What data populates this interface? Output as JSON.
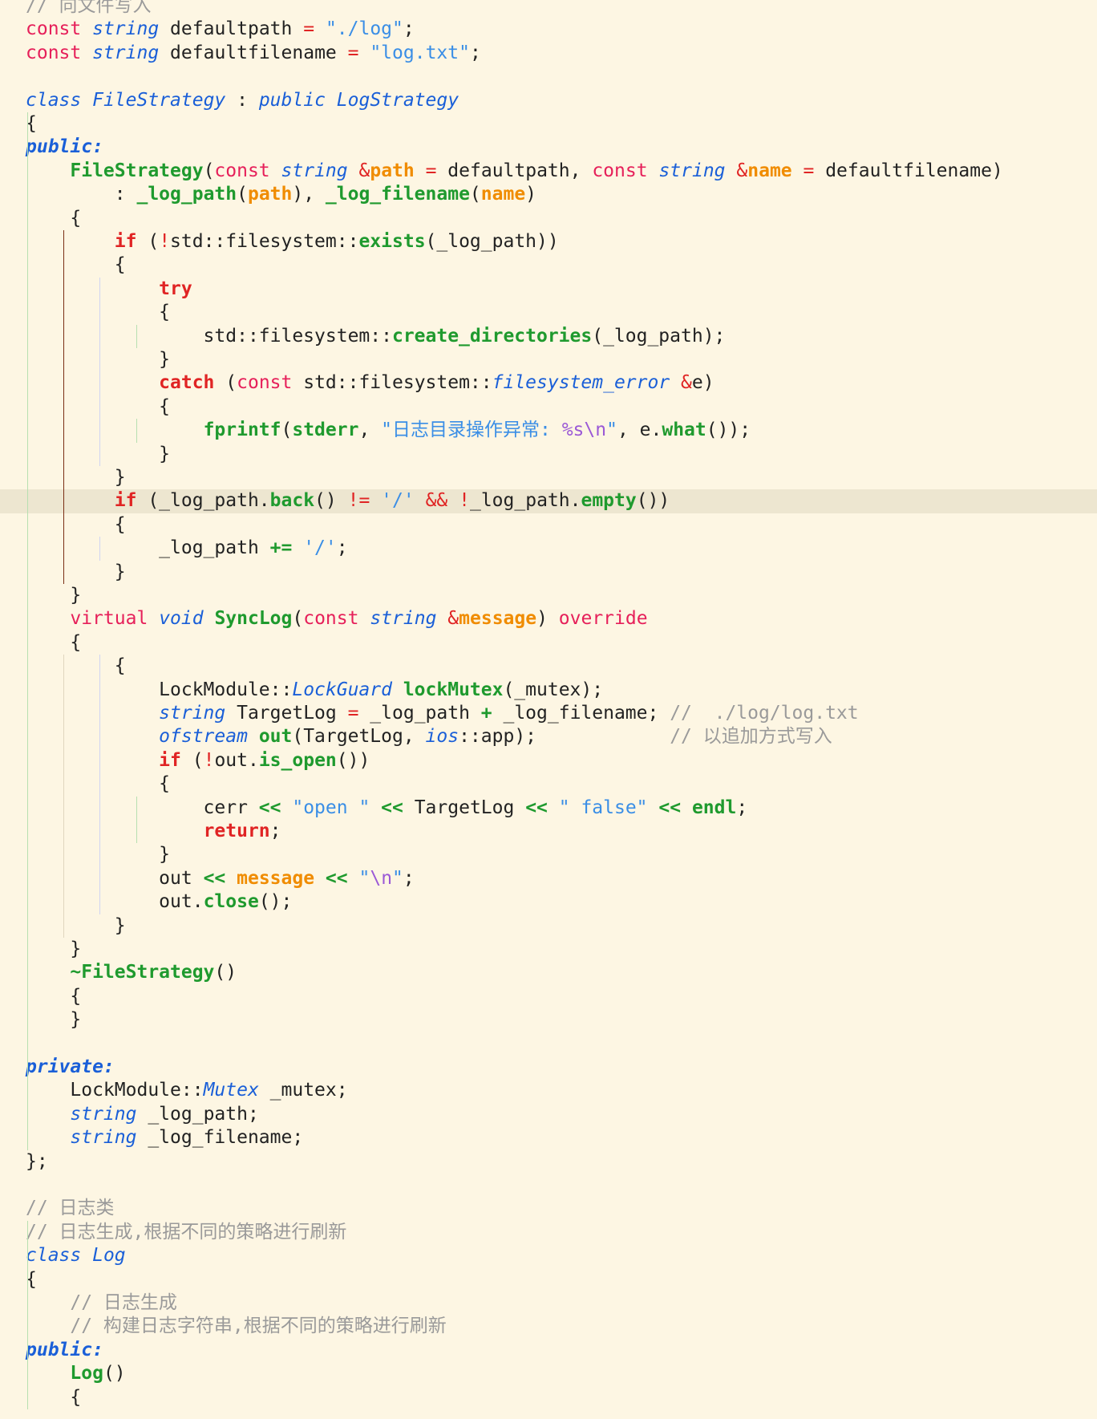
{
  "editor": {
    "language": "cpp",
    "theme_background": "#fdf6e3",
    "current_line_background": "#ede6d0",
    "colors": {
      "comment": "#9a9a9a",
      "keyword": "#e6205a",
      "control": "#e02424",
      "type": "#1a5fd8",
      "function": "#1f9a2e",
      "param": "#f08c00",
      "string": "#3a8ee6",
      "escape": "#9b59d6"
    },
    "current_line": 21,
    "lines": [
      [
        {
          "t": "cm",
          "s": "// 向文件写入"
        }
      ],
      [
        {
          "t": "kw",
          "s": "const"
        },
        {
          "t": "nm",
          "s": " "
        },
        {
          "t": "ty",
          "s": "string"
        },
        {
          "t": "nm",
          "s": " defaultpath "
        },
        {
          "t": "op",
          "s": "="
        },
        {
          "t": "nm",
          "s": " "
        },
        {
          "t": "st",
          "s": "\"./log\""
        },
        {
          "t": "nm",
          "s": ";"
        }
      ],
      [
        {
          "t": "kw",
          "s": "const"
        },
        {
          "t": "nm",
          "s": " "
        },
        {
          "t": "ty",
          "s": "string"
        },
        {
          "t": "nm",
          "s": " defaultfilename "
        },
        {
          "t": "op",
          "s": "="
        },
        {
          "t": "nm",
          "s": " "
        },
        {
          "t": "st",
          "s": "\"log.txt\""
        },
        {
          "t": "nm",
          "s": ";"
        }
      ],
      [],
      [
        {
          "t": "ty",
          "s": "class"
        },
        {
          "t": "nm",
          "s": " "
        },
        {
          "t": "ty",
          "s": "FileStrategy"
        },
        {
          "t": "nm",
          "s": " : "
        },
        {
          "t": "ty",
          "s": "public"
        },
        {
          "t": "nm",
          "s": " "
        },
        {
          "t": "ty",
          "s": "LogStrategy"
        }
      ],
      [
        {
          "t": "nm",
          "s": "{"
        }
      ],
      [
        {
          "t": "sec",
          "s": "public:"
        }
      ],
      [
        {
          "t": "nm",
          "s": "    "
        },
        {
          "t": "fn",
          "s": "FileStrategy"
        },
        {
          "t": "nm",
          "s": "("
        },
        {
          "t": "kw",
          "s": "const"
        },
        {
          "t": "nm",
          "s": " "
        },
        {
          "t": "ty",
          "s": "string"
        },
        {
          "t": "nm",
          "s": " "
        },
        {
          "t": "op",
          "s": "&"
        },
        {
          "t": "pm",
          "s": "path"
        },
        {
          "t": "nm",
          "s": " "
        },
        {
          "t": "op",
          "s": "="
        },
        {
          "t": "nm",
          "s": " defaultpath, "
        },
        {
          "t": "kw",
          "s": "const"
        },
        {
          "t": "nm",
          "s": " "
        },
        {
          "t": "ty",
          "s": "string"
        },
        {
          "t": "nm",
          "s": " "
        },
        {
          "t": "op",
          "s": "&"
        },
        {
          "t": "pm",
          "s": "name"
        },
        {
          "t": "nm",
          "s": " "
        },
        {
          "t": "op",
          "s": "="
        },
        {
          "t": "nm",
          "s": " defaultfilename)"
        }
      ],
      [
        {
          "t": "nm",
          "s": "        : "
        },
        {
          "t": "fn",
          "s": "_log_path"
        },
        {
          "t": "nm",
          "s": "("
        },
        {
          "t": "pm",
          "s": "path"
        },
        {
          "t": "nm",
          "s": "), "
        },
        {
          "t": "fn",
          "s": "_log_filename"
        },
        {
          "t": "nm",
          "s": "("
        },
        {
          "t": "pm",
          "s": "name"
        },
        {
          "t": "nm",
          "s": ")"
        }
      ],
      [
        {
          "t": "nm",
          "s": "    {"
        }
      ],
      [
        {
          "t": "nm",
          "s": "        "
        },
        {
          "t": "ctl",
          "s": "if"
        },
        {
          "t": "nm",
          "s": " ("
        },
        {
          "t": "op",
          "s": "!"
        },
        {
          "t": "nm",
          "s": "std::filesystem::"
        },
        {
          "t": "fn",
          "s": "exists"
        },
        {
          "t": "nm",
          "s": "(_log_path))"
        }
      ],
      [
        {
          "t": "nm",
          "s": "        {"
        }
      ],
      [
        {
          "t": "nm",
          "s": "            "
        },
        {
          "t": "ctl",
          "s": "try"
        }
      ],
      [
        {
          "t": "nm",
          "s": "            {"
        }
      ],
      [
        {
          "t": "nm",
          "s": "                std::filesystem::"
        },
        {
          "t": "fn",
          "s": "create_directories"
        },
        {
          "t": "nm",
          "s": "(_log_path);"
        }
      ],
      [
        {
          "t": "nm",
          "s": "            }"
        }
      ],
      [
        {
          "t": "nm",
          "s": "            "
        },
        {
          "t": "ctl",
          "s": "catch"
        },
        {
          "t": "nm",
          "s": " ("
        },
        {
          "t": "kw",
          "s": "const"
        },
        {
          "t": "nm",
          "s": " std::filesystem::"
        },
        {
          "t": "ty",
          "s": "filesystem_error"
        },
        {
          "t": "nm",
          "s": " "
        },
        {
          "t": "op",
          "s": "&"
        },
        {
          "t": "nm",
          "s": "e)"
        }
      ],
      [
        {
          "t": "nm",
          "s": "            {"
        }
      ],
      [
        {
          "t": "nm",
          "s": "                "
        },
        {
          "t": "fn",
          "s": "fprintf"
        },
        {
          "t": "nm",
          "s": "("
        },
        {
          "t": "fn",
          "s": "stderr"
        },
        {
          "t": "nm",
          "s": ", "
        },
        {
          "t": "st",
          "s": "\"日志目录操作异常: "
        },
        {
          "t": "esc",
          "s": "%s\\n"
        },
        {
          "t": "st",
          "s": "\""
        },
        {
          "t": "nm",
          "s": ", e."
        },
        {
          "t": "fn",
          "s": "what"
        },
        {
          "t": "nm",
          "s": "());"
        }
      ],
      [
        {
          "t": "nm",
          "s": "            }"
        }
      ],
      [
        {
          "t": "nm",
          "s": "        }"
        }
      ],
      [
        {
          "t": "nm",
          "s": "        "
        },
        {
          "t": "ctl",
          "s": "if"
        },
        {
          "t": "nm",
          "s": " (_log_path."
        },
        {
          "t": "fn",
          "s": "back"
        },
        {
          "t": "nm",
          "s": "() "
        },
        {
          "t": "op",
          "s": "!="
        },
        {
          "t": "nm",
          "s": " "
        },
        {
          "t": "st",
          "s": "'/'"
        },
        {
          "t": "nm",
          "s": " "
        },
        {
          "t": "op",
          "s": "&&"
        },
        {
          "t": "nm",
          "s": " "
        },
        {
          "t": "op",
          "s": "!"
        },
        {
          "t": "nm",
          "s": "_log_path."
        },
        {
          "t": "fn",
          "s": "empty"
        },
        {
          "t": "nm",
          "s": "())"
        }
      ],
      [
        {
          "t": "nm",
          "s": "        {"
        }
      ],
      [
        {
          "t": "nm",
          "s": "            _log_path "
        },
        {
          "t": "sop",
          "s": "+="
        },
        {
          "t": "nm",
          "s": " "
        },
        {
          "t": "st",
          "s": "'/'"
        },
        {
          "t": "nm",
          "s": ";"
        }
      ],
      [
        {
          "t": "nm",
          "s": "        }"
        }
      ],
      [
        {
          "t": "nm",
          "s": "    }"
        }
      ],
      [
        {
          "t": "nm",
          "s": "    "
        },
        {
          "t": "kw",
          "s": "virtual"
        },
        {
          "t": "nm",
          "s": " "
        },
        {
          "t": "ty",
          "s": "void"
        },
        {
          "t": "nm",
          "s": " "
        },
        {
          "t": "fn",
          "s": "SyncLog"
        },
        {
          "t": "nm",
          "s": "("
        },
        {
          "t": "kw",
          "s": "const"
        },
        {
          "t": "nm",
          "s": " "
        },
        {
          "t": "ty",
          "s": "string"
        },
        {
          "t": "nm",
          "s": " "
        },
        {
          "t": "op",
          "s": "&"
        },
        {
          "t": "pm",
          "s": "message"
        },
        {
          "t": "nm",
          "s": ") "
        },
        {
          "t": "kw",
          "s": "override"
        }
      ],
      [
        {
          "t": "nm",
          "s": "    {"
        }
      ],
      [
        {
          "t": "nm",
          "s": "        {"
        }
      ],
      [
        {
          "t": "nm",
          "s": "            LockModule::"
        },
        {
          "t": "ty",
          "s": "LockGuard"
        },
        {
          "t": "nm",
          "s": " "
        },
        {
          "t": "fn",
          "s": "lockMutex"
        },
        {
          "t": "nm",
          "s": "(_mutex);"
        }
      ],
      [
        {
          "t": "nm",
          "s": "            "
        },
        {
          "t": "ty",
          "s": "string"
        },
        {
          "t": "nm",
          "s": " TargetLog "
        },
        {
          "t": "op",
          "s": "="
        },
        {
          "t": "nm",
          "s": " _log_path "
        },
        {
          "t": "sop",
          "s": "+"
        },
        {
          "t": "nm",
          "s": " _log_filename; "
        },
        {
          "t": "cm",
          "s": "//  ./log/log.txt"
        }
      ],
      [
        {
          "t": "nm",
          "s": "            "
        },
        {
          "t": "ty",
          "s": "ofstream"
        },
        {
          "t": "nm",
          "s": " "
        },
        {
          "t": "fn",
          "s": "out"
        },
        {
          "t": "nm",
          "s": "(TargetLog, "
        },
        {
          "t": "ty",
          "s": "ios"
        },
        {
          "t": "nm",
          "s": "::app);            "
        },
        {
          "t": "cm",
          "s": "// 以追加方式写入"
        }
      ],
      [
        {
          "t": "nm",
          "s": "            "
        },
        {
          "t": "ctl",
          "s": "if"
        },
        {
          "t": "nm",
          "s": " ("
        },
        {
          "t": "op",
          "s": "!"
        },
        {
          "t": "nm",
          "s": "out."
        },
        {
          "t": "fn",
          "s": "is_open"
        },
        {
          "t": "nm",
          "s": "())"
        }
      ],
      [
        {
          "t": "nm",
          "s": "            {"
        }
      ],
      [
        {
          "t": "nm",
          "s": "                cerr "
        },
        {
          "t": "sop",
          "s": "<<"
        },
        {
          "t": "nm",
          "s": " "
        },
        {
          "t": "st",
          "s": "\"open \""
        },
        {
          "t": "nm",
          "s": " "
        },
        {
          "t": "sop",
          "s": "<<"
        },
        {
          "t": "nm",
          "s": " TargetLog "
        },
        {
          "t": "sop",
          "s": "<<"
        },
        {
          "t": "nm",
          "s": " "
        },
        {
          "t": "st",
          "s": "\" false\""
        },
        {
          "t": "nm",
          "s": " "
        },
        {
          "t": "sop",
          "s": "<<"
        },
        {
          "t": "nm",
          "s": " "
        },
        {
          "t": "fn",
          "s": "endl"
        },
        {
          "t": "nm",
          "s": ";"
        }
      ],
      [
        {
          "t": "nm",
          "s": "                "
        },
        {
          "t": "ctl",
          "s": "return"
        },
        {
          "t": "nm",
          "s": ";"
        }
      ],
      [
        {
          "t": "nm",
          "s": "            }"
        }
      ],
      [
        {
          "t": "nm",
          "s": "            out "
        },
        {
          "t": "sop",
          "s": "<<"
        },
        {
          "t": "nm",
          "s": " "
        },
        {
          "t": "pm",
          "s": "message"
        },
        {
          "t": "nm",
          "s": " "
        },
        {
          "t": "sop",
          "s": "<<"
        },
        {
          "t": "nm",
          "s": " "
        },
        {
          "t": "st",
          "s": "\""
        },
        {
          "t": "esc",
          "s": "\\n"
        },
        {
          "t": "st",
          "s": "\""
        },
        {
          "t": "nm",
          "s": ";"
        }
      ],
      [
        {
          "t": "nm",
          "s": "            out."
        },
        {
          "t": "fn",
          "s": "close"
        },
        {
          "t": "nm",
          "s": "();"
        }
      ],
      [
        {
          "t": "nm",
          "s": "        }"
        }
      ],
      [
        {
          "t": "nm",
          "s": "    }"
        }
      ],
      [
        {
          "t": "nm",
          "s": "    "
        },
        {
          "t": "fn",
          "s": "~FileStrategy"
        },
        {
          "t": "nm",
          "s": "()"
        }
      ],
      [
        {
          "t": "nm",
          "s": "    {"
        }
      ],
      [
        {
          "t": "nm",
          "s": "    }"
        }
      ],
      [],
      [
        {
          "t": "sec",
          "s": "private:"
        }
      ],
      [
        {
          "t": "nm",
          "s": "    LockModule::"
        },
        {
          "t": "ty",
          "s": "Mutex"
        },
        {
          "t": "nm",
          "s": " _mutex;"
        }
      ],
      [
        {
          "t": "nm",
          "s": "    "
        },
        {
          "t": "ty",
          "s": "string"
        },
        {
          "t": "nm",
          "s": " _log_path;"
        }
      ],
      [
        {
          "t": "nm",
          "s": "    "
        },
        {
          "t": "ty",
          "s": "string"
        },
        {
          "t": "nm",
          "s": " _log_filename;"
        }
      ],
      [
        {
          "t": "nm",
          "s": "};"
        }
      ],
      [],
      [
        {
          "t": "cm",
          "s": "// 日志类"
        }
      ],
      [
        {
          "t": "cm",
          "s": "// 日志生成,根据不同的策略进行刷新"
        }
      ],
      [
        {
          "t": "ty",
          "s": "class"
        },
        {
          "t": "nm",
          "s": " "
        },
        {
          "t": "ty",
          "s": "Log"
        }
      ],
      [
        {
          "t": "nm",
          "s": "{"
        }
      ],
      [
        {
          "t": "nm",
          "s": "    "
        },
        {
          "t": "cm",
          "s": "// 日志生成"
        }
      ],
      [
        {
          "t": "nm",
          "s": "    "
        },
        {
          "t": "cm",
          "s": "// 构建日志字符串,根据不同的策略进行刷新"
        }
      ],
      [
        {
          "t": "sec",
          "s": "public:"
        }
      ],
      [
        {
          "t": "nm",
          "s": "    "
        },
        {
          "t": "fn",
          "s": "Log"
        },
        {
          "t": "nm",
          "s": "()"
        }
      ],
      [
        {
          "t": "nm",
          "s": "    {"
        }
      ]
    ]
  }
}
